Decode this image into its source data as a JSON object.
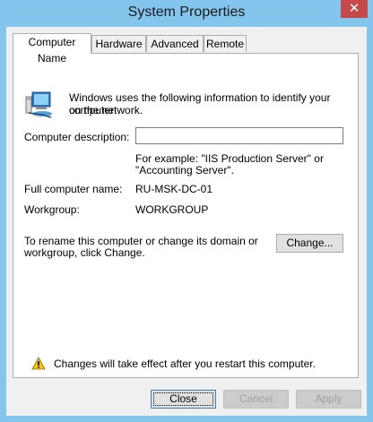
{
  "window": {
    "title": "System Properties",
    "close_glyph": "✕"
  },
  "tabs": [
    {
      "label": "Computer Name",
      "active": true
    },
    {
      "label": "Hardware",
      "active": false
    },
    {
      "label": "Advanced",
      "active": false
    },
    {
      "label": "Remote",
      "active": false
    }
  ],
  "computer_name_tab": {
    "intro_line1": "Windows uses the following information to identify your computer",
    "intro_line2": "on the network.",
    "description_label": "Computer description:",
    "description_value": "",
    "example_line1": "For example: \"IIS Production Server\" or",
    "example_line2": "\"Accounting Server\".",
    "full_name_label": "Full computer name:",
    "full_name_value": "RU-MSK-DC-01",
    "workgroup_label": "Workgroup:",
    "workgroup_value": "WORKGROUP",
    "rename_line1": "To rename this computer or change its domain or",
    "rename_line2": "workgroup, click Change.",
    "change_button": "Change...",
    "warning_text": "Changes will take effect after you restart this computer."
  },
  "footer": {
    "close_button": "Close",
    "cancel_button": "Cancel",
    "apply_button": "Apply"
  },
  "colors": {
    "frame": "#84c5ee",
    "close_box": "#c74848",
    "warning": "#f2c811"
  },
  "icons": [
    "computer-network-icon",
    "warning-icon",
    "close-icon"
  ]
}
